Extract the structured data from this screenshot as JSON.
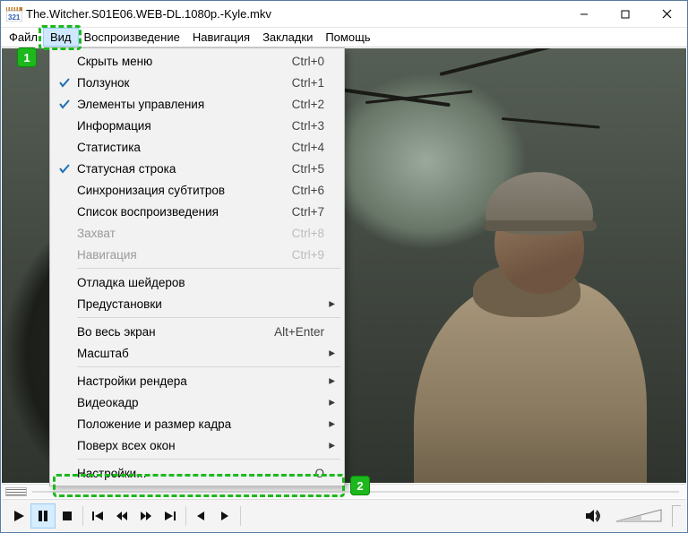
{
  "window": {
    "title": "The.Witcher.S01E06.WEB-DL.1080p.-Kyle.mkv"
  },
  "menubar": {
    "items": [
      {
        "label": "Файл"
      },
      {
        "label": "Вид"
      },
      {
        "label": "Воспроизведение"
      },
      {
        "label": "Навигация"
      },
      {
        "label": "Закладки"
      },
      {
        "label": "Помощь"
      }
    ],
    "open_index": 1
  },
  "dropdown": {
    "sections": [
      [
        {
          "label": "Скрыть меню",
          "shortcut": "Ctrl+0"
        },
        {
          "label": "Ползунок",
          "shortcut": "Ctrl+1",
          "checked": true
        },
        {
          "label": "Элементы управления",
          "shortcut": "Ctrl+2",
          "checked": true
        },
        {
          "label": "Информация",
          "shortcut": "Ctrl+3"
        },
        {
          "label": "Статистика",
          "shortcut": "Ctrl+4"
        },
        {
          "label": "Статусная строка",
          "shortcut": "Ctrl+5",
          "checked": true
        },
        {
          "label": "Синхронизация субтитров",
          "shortcut": "Ctrl+6"
        },
        {
          "label": "Список воспроизведения",
          "shortcut": "Ctrl+7"
        },
        {
          "label": "Захват",
          "shortcut": "Ctrl+8",
          "disabled": true
        },
        {
          "label": "Навигация",
          "shortcut": "Ctrl+9",
          "disabled": true
        }
      ],
      [
        {
          "label": "Отладка шейдеров"
        },
        {
          "label": "Предустановки",
          "submenu": true
        }
      ],
      [
        {
          "label": "Во весь экран",
          "shortcut": "Alt+Enter"
        },
        {
          "label": "Масштаб",
          "submenu": true
        }
      ],
      [
        {
          "label": "Настройки рендера",
          "submenu": true
        },
        {
          "label": "Видеокадр",
          "submenu": true
        },
        {
          "label": "Положение и размер кадра",
          "submenu": true
        },
        {
          "label": "Поверх всех окон",
          "submenu": true
        }
      ],
      [
        {
          "label": "Настройки...",
          "shortcut": "O"
        }
      ]
    ]
  },
  "annotations": {
    "one": "1",
    "two": "2"
  }
}
